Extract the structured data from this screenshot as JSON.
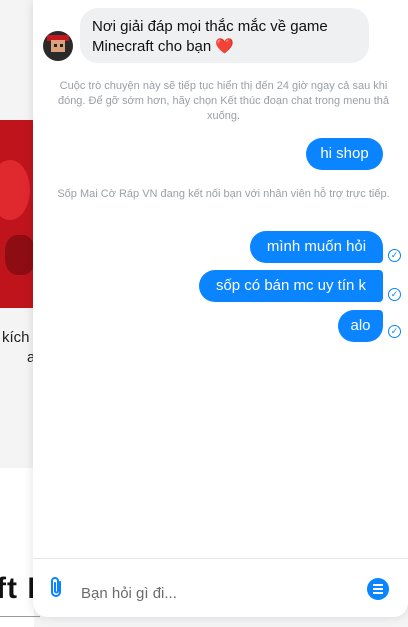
{
  "background": {
    "partial_text_1": "kích",
    "partial_text_2": "a",
    "partial_heading": "ft E"
  },
  "chat": {
    "welcome_message": "Nơi giải đáp mọi thắc mắc về game Minecraft cho bạn",
    "welcome_emoji": "❤️",
    "system_notice_1": "Cuộc trò chuyện này sẽ tiếp tục hiển thị đến 24 giờ ngay cả sau khi đóng. Để gỡ sớm hơn, hãy chọn Kết thúc đoạn chat trong menu thả xuống.",
    "system_notice_2": "Sốp Mai Cờ Ráp VN đang kết nối bạn với nhân viên hỗ trợ trực tiếp.",
    "outgoing": [
      {
        "text": "hi shop"
      },
      {
        "text": "mình muốn hỏi"
      },
      {
        "text": "sốp có bán mc uy tín k"
      },
      {
        "text": "alo"
      }
    ],
    "input_placeholder": "Bạn hỏi gì đi...",
    "colors": {
      "accent": "#0a84ff",
      "incoming_bubble": "#eef0f2"
    }
  }
}
